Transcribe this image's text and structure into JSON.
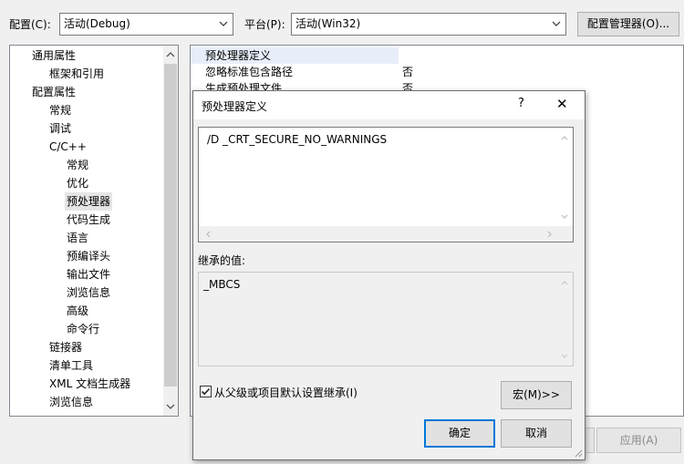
{
  "toolbar": {
    "config_label": "配置(C):",
    "config_value": "活动(Debug)",
    "platform_label": "平台(P):",
    "platform_value": "活动(Win32)",
    "config_manager_button": "配置管理器(O)..."
  },
  "tree": {
    "items": [
      {
        "label": "通用属性",
        "level": 0
      },
      {
        "label": "框架和引用",
        "level": 1
      },
      {
        "label": "配置属性",
        "level": 0
      },
      {
        "label": "常规",
        "level": 1
      },
      {
        "label": "调试",
        "level": 1
      },
      {
        "label": "C/C++",
        "level": 1
      },
      {
        "label": "常规",
        "level": 2
      },
      {
        "label": "优化",
        "level": 2
      },
      {
        "label": "预处理器",
        "level": 2,
        "selected": true
      },
      {
        "label": "代码生成",
        "level": 2
      },
      {
        "label": "语言",
        "level": 2
      },
      {
        "label": "预编译头",
        "level": 2
      },
      {
        "label": "输出文件",
        "level": 2
      },
      {
        "label": "浏览信息",
        "level": 2
      },
      {
        "label": "高级",
        "level": 2
      },
      {
        "label": "命令行",
        "level": 2
      },
      {
        "label": "链接器",
        "level": 1
      },
      {
        "label": "清单工具",
        "level": 1
      },
      {
        "label": "XML 文档生成器",
        "level": 1
      },
      {
        "label": "浏览信息",
        "level": 1
      }
    ]
  },
  "grid": {
    "rows": [
      {
        "name": "预处理器定义",
        "value": ""
      },
      {
        "name": "忽略标准包含路径",
        "value": "否"
      },
      {
        "name": "生成预处理文件",
        "value": "否"
      }
    ]
  },
  "dialog": {
    "title": "预处理器定义",
    "help_glyph": "?",
    "close_glyph": "✕",
    "edit_value": "/D _CRT_SECURE_NO_WARNINGS",
    "inherited_label": "继承的值:",
    "inherited_value": "_MBCS",
    "inherit_checkbox_label": "从父级或项目默认设置继承(I)",
    "inherit_checked": true,
    "macros_button": "宏(M)>>",
    "ok_button": "确定",
    "cancel_button": "取消"
  },
  "footer": {
    "apply_button": "应用(A)"
  }
}
